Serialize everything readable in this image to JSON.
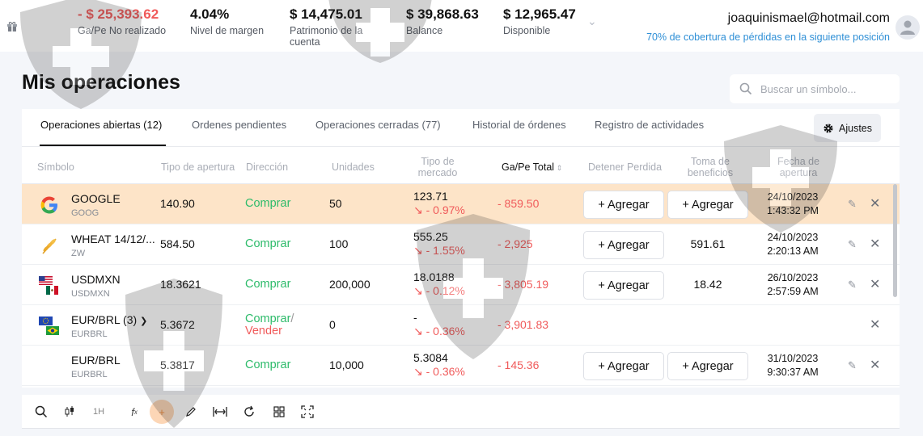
{
  "topbar": {
    "stats": [
      {
        "value": "- $ 25,393.62",
        "label": "Ga/Pe No realizado"
      },
      {
        "value": "4.04%",
        "label": "Nivel de margen"
      },
      {
        "value": "$ 14,475.01",
        "label": "Patrimonio de la cuenta"
      },
      {
        "value": "$ 39,868.63",
        "label": "Balance"
      },
      {
        "value": "$ 12,965.47",
        "label": "Disponible"
      }
    ],
    "email": "joaquinismael@hotmail.com",
    "coverage": "70% de cobertura de pérdidas en la siguiente posición"
  },
  "page": {
    "title": "Mis operaciones",
    "search_placeholder": "Buscar un símbolo..."
  },
  "tabs": [
    {
      "label": "Operaciones abiertas (12)",
      "active": true
    },
    {
      "label": "Ordenes pendientes"
    },
    {
      "label": "Operaciones cerradas (77)"
    },
    {
      "label": "Historial de órdenes"
    },
    {
      "label": "Registro de actividades"
    }
  ],
  "settings_label": "Ajustes",
  "columns": {
    "symbol": "Símbolo",
    "open_type": "Tipo de apertura",
    "direction": "Dirección",
    "units": "Unidades",
    "market_type": "Tipo de mercado",
    "pnl_total": "Ga/Pe Total",
    "stop_loss": "Detener Perdida",
    "take_profit": "Toma de beneficios",
    "open_date": "Fecha de apertura"
  },
  "rows": [
    {
      "name": "GOOGLE",
      "code": "GOOG",
      "open": "140.90",
      "dir": "Comprar",
      "units": "50",
      "mkt": "123.71",
      "chg": "↘ - 0.97%",
      "pnl": "- 859.50",
      "sl": "+ Agregar",
      "tp": "+ Agregar",
      "date": "24/10/2023",
      "time": "1:43:32 PM"
    },
    {
      "name": "WHEAT 14/12/...",
      "code": "ZW",
      "open": "584.50",
      "dir": "Comprar",
      "units": "100",
      "mkt": "555.25",
      "chg": "↘ - 1.55%",
      "pnl": "- 2,925",
      "sl": "+ Agregar",
      "tp": "591.61",
      "date": "24/10/2023",
      "time": "2:20:13 AM"
    },
    {
      "name": "USDMXN",
      "code": "USDMXN",
      "open": "18.3621",
      "dir": "Comprar",
      "units": "200,000",
      "mkt": "18.0188",
      "chg": "↘ - 0.12%",
      "pnl": "- 3,805.19",
      "sl": "+ Agregar",
      "tp": "18.42",
      "date": "26/10/2023",
      "time": "2:57:59 AM"
    },
    {
      "name": "EUR/BRL (3)",
      "code": "EURBRL",
      "open": "5.3672",
      "dir": "Comprar",
      "dir2": "Vender",
      "units": "0",
      "mkt": "-",
      "chg": "↘ - 0.36%",
      "pnl": "- 3,901.83"
    },
    {
      "name": "EUR/BRL",
      "code": "EURBRL",
      "open": "5.3817",
      "dir": "Comprar",
      "units": "10,000",
      "mkt": "5.3084",
      "chg": "↘ - 0.36%",
      "pnl": "- 145.36",
      "sl": "+ Agregar",
      "tp": "+ Agregar",
      "date": "31/10/2023",
      "time": "9:30:37 AM"
    }
  ],
  "toolbar": {
    "interval": "1H"
  }
}
